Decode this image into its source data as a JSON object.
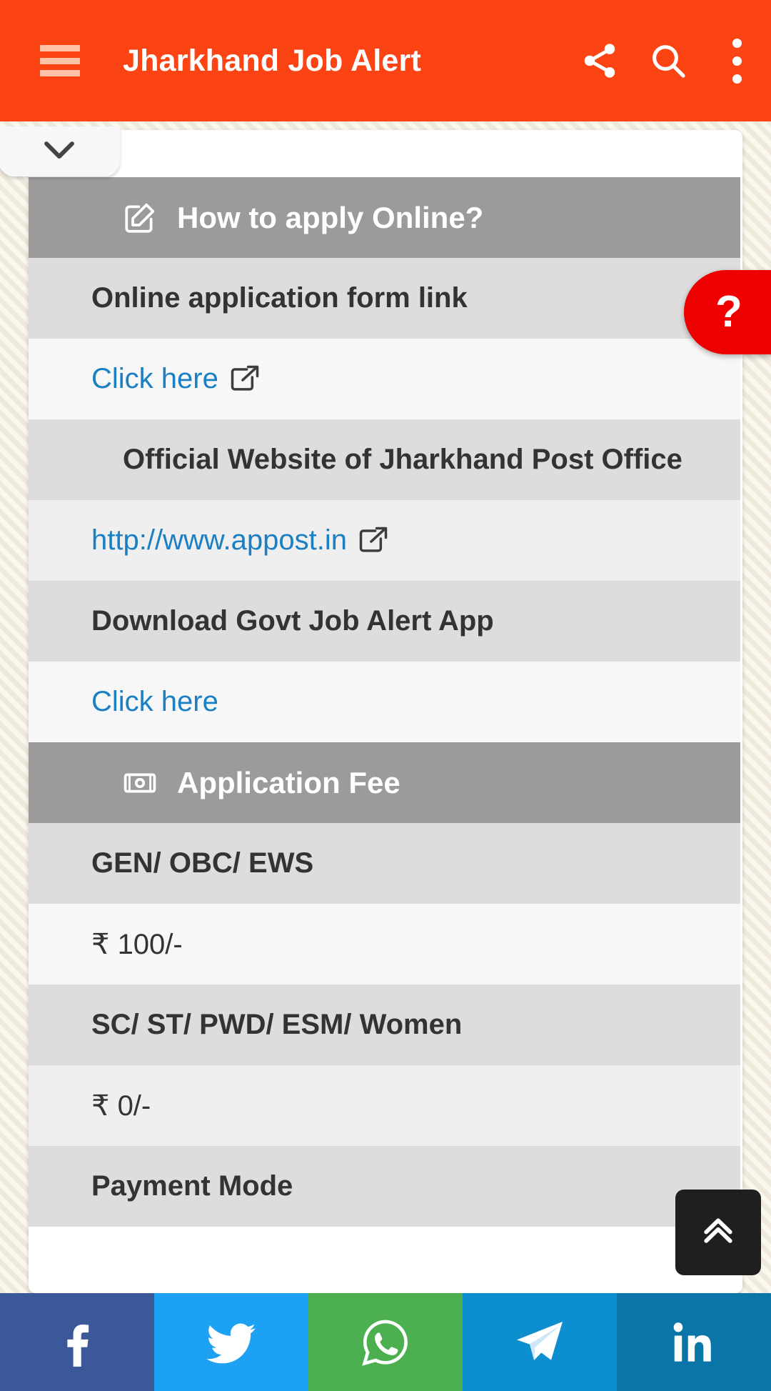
{
  "appbar": {
    "title": "Jharkhand Job Alert",
    "menu_icon": "hamburger-menu-icon",
    "share_icon": "share-icon",
    "search_icon": "search-icon",
    "overflow_icon": "more-vertical-icon",
    "background_color": "#fb4314",
    "title_color": "#ffffff"
  },
  "collapse_tab": {
    "icon": "chevron-down-icon"
  },
  "help_button": {
    "label": "?",
    "color": "#ee0000"
  },
  "scroll_top_button": {
    "icon": "double-chevron-up-icon",
    "color": "#1f1f1f"
  },
  "table": {
    "rows": [
      {
        "type": "header",
        "icon": "edit-pencil-icon",
        "text": "How to apply Online?"
      },
      {
        "type": "label",
        "text": "Online application form link"
      },
      {
        "type": "value-a",
        "text": "Click here",
        "link": true,
        "external": true
      },
      {
        "type": "label-wrap",
        "text": "Official Website of Jharkhand Post Office"
      },
      {
        "type": "value-b",
        "text": "http://www.appost.in",
        "link": true,
        "external": true
      },
      {
        "type": "label",
        "text": "Download Govt Job Alert App"
      },
      {
        "type": "value-a",
        "text": "Click here",
        "link": true,
        "external": false
      },
      {
        "type": "header",
        "icon": "money-note-icon",
        "text": "Application Fee"
      },
      {
        "type": "label",
        "text": "GEN/ OBC/ EWS"
      },
      {
        "type": "value-a",
        "text": "₹ 100/-"
      },
      {
        "type": "label",
        "text": "SC/ ST/ PWD/ ESM/ Women"
      },
      {
        "type": "value-b",
        "text": "₹ 0/-"
      },
      {
        "type": "label",
        "text": "Payment Mode"
      }
    ]
  },
  "social_bar": {
    "items": [
      {
        "name": "facebook",
        "icon": "facebook-icon",
        "color": "#3b5998"
      },
      {
        "name": "twitter",
        "icon": "twitter-icon",
        "color": "#1da1f2"
      },
      {
        "name": "whatsapp",
        "icon": "whatsapp-icon",
        "color": "#4caf50"
      },
      {
        "name": "telegram",
        "icon": "telegram-icon",
        "color": "#0d8ecf"
      },
      {
        "name": "linkedin",
        "icon": "linkedin-icon",
        "color": "#0a76a8"
      }
    ]
  }
}
